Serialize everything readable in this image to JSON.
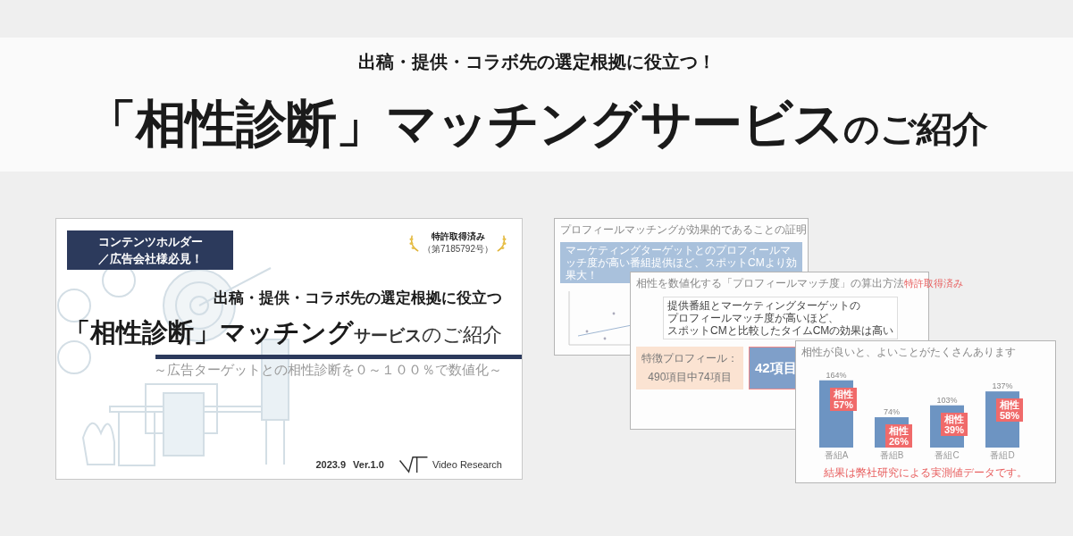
{
  "header": {
    "subtitle": "出稿・提供・コラボ先の選定根拠に役立つ！",
    "title_main": "「相性診断」マッチングサービス",
    "title_suffix": "のご紹介"
  },
  "cover_slide": {
    "audience_banner": [
      "コンテンツホルダー",
      "／広告会社様必見！"
    ],
    "patent_badge": {
      "label": "特許取得済み",
      "number": "（第7185792号）"
    },
    "lead": "出稿・提供・コラボ先の選定根拠に役立つ",
    "title_main": "「相性診断」マッチング",
    "title_service": "サービス",
    "title_suffix": "のご紹介",
    "tagline": "～広告ターゲットとの相性診断を０～１００％で数値化～",
    "date": "2023.9",
    "version": "Ver.1.0",
    "logo_text": "Video Research"
  },
  "preview_slides": [
    {
      "kind": "scatter",
      "title": "プロフィールマッチングが効果的であることの証明",
      "banner": "マーケティングターゲットとのプロフィールマッチ度が高い番組提供ほど、スポットCMより効果大！"
    },
    {
      "kind": "method",
      "title": "相性を数値化する「プロフィールマッチ度」の算出方法",
      "tag": "特許取得済み",
      "callout": [
        "提供番組とマーケティングターゲットの",
        "プロフィールマッチ度が高いほど、",
        "スポットCMと比較したタイムCMの効果は高い"
      ],
      "profile_label": "特徴プロフィール：",
      "profile_count": "490項目中74項目",
      "match_count": "42項目"
    },
    {
      "kind": "chart",
      "title": "相性が良いと、よいことがたくさんあります",
      "footnote": "結果は弊社研究による実測値データです。",
      "chart_data": {
        "type": "bar",
        "categories": [
          "番組A",
          "番組B",
          "番組C",
          "番組D"
        ],
        "values": [
          164,
          74,
          103,
          137
        ],
        "value_labels": [
          "164%",
          "74%",
          "103%",
          "137%"
        ],
        "data_labels": true,
        "annotations": [
          "相性 57%",
          "相性 26%",
          "相性 39%",
          "相性 58%"
        ]
      }
    }
  ]
}
